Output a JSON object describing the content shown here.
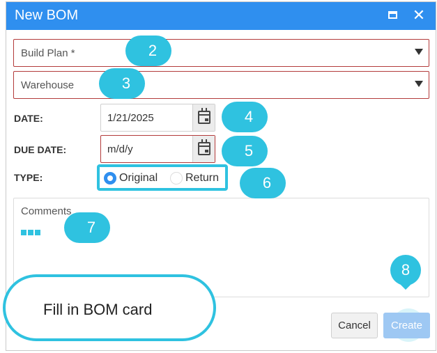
{
  "dialog": {
    "title": "New BOM"
  },
  "form": {
    "build_plan_label": "Build Plan *",
    "warehouse_label": "Warehouse",
    "date_label": "DATE:",
    "date_value": "1/21/2025",
    "due_date_label": "DUE DATE:",
    "due_date_placeholder": "m/d/y",
    "type_label": "TYPE:",
    "type_options": [
      {
        "label": "Original",
        "checked": true
      },
      {
        "label": "Return",
        "checked": false
      }
    ],
    "comments_label": "Comments"
  },
  "buttons": {
    "cancel": "Cancel",
    "create": "Create"
  },
  "annotations": {
    "steps": [
      "2",
      "3",
      "4",
      "5",
      "6",
      "7",
      "8"
    ],
    "tooltip": "Fill in BOM card"
  },
  "colors": {
    "titlebar": "#2f8fef",
    "callout": "#2fc2e0",
    "error_border": "#b33a3a",
    "create_disabled": "#9ec8f3"
  },
  "icons": {
    "maximize": "maximize-icon",
    "close": "close-icon",
    "dropdown": "caret-down-icon",
    "calendar": "calendar-icon"
  }
}
